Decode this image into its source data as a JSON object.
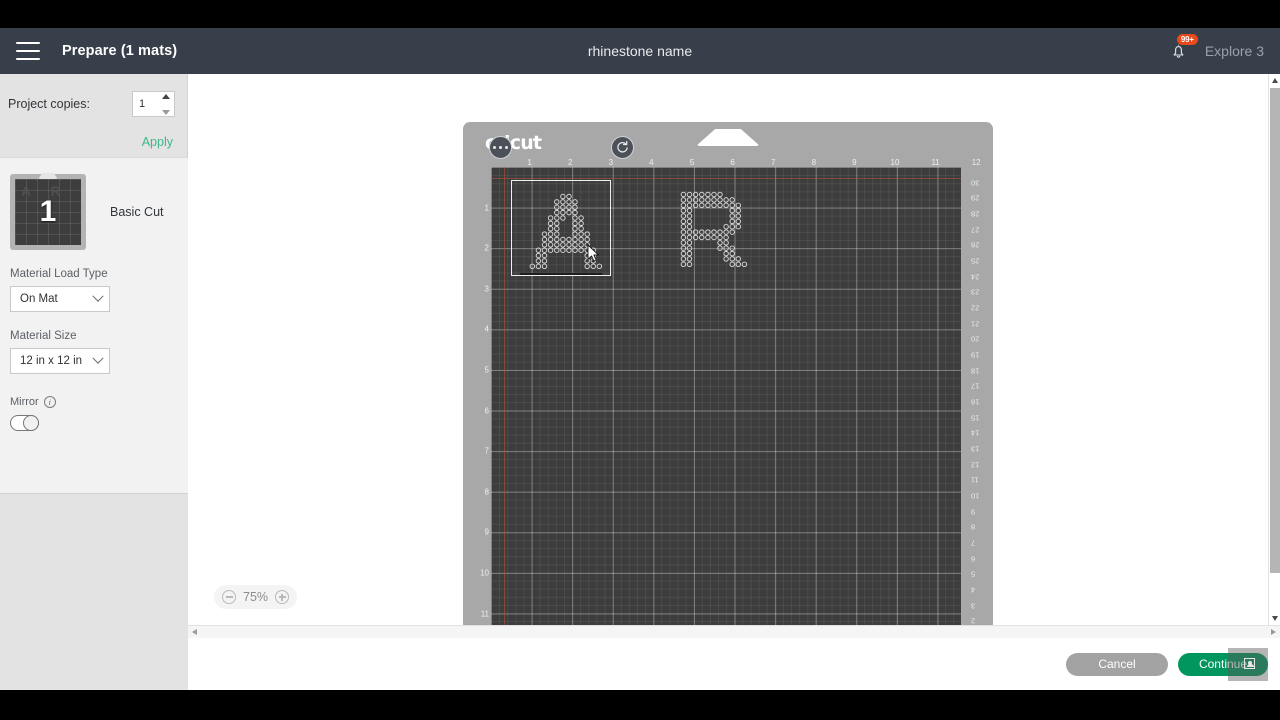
{
  "header": {
    "menu_icon": "hamburger-menu-icon",
    "title": "Prepare (1 mats)",
    "project_name": "rhinestone name",
    "bell_icon": "notification-bell-icon",
    "notification_badge": "99+",
    "machine": "Explore 3"
  },
  "sidebar": {
    "copies_label": "Project copies:",
    "copies_value": "1",
    "apply_label": "Apply",
    "mat": {
      "number": "1",
      "operation_label": "Basic Cut",
      "thumb_letters": "A R"
    },
    "material_load_type_label": "Material Load Type",
    "material_load_type_value": "On Mat",
    "material_size_label": "Material Size",
    "material_size_value": "12 in x 12 in",
    "mirror_label": "Mirror",
    "mirror_info_icon": "info-icon",
    "mirror_enabled": false
  },
  "canvas": {
    "mat_brand": "cricut",
    "more_options_icon": "ellipsis-icon",
    "rotate_icon": "rotate-icon",
    "ruler_top_ticks": [
      "1",
      "2",
      "3",
      "4",
      "5",
      "6",
      "7",
      "8",
      "9",
      "10",
      "11",
      "12"
    ],
    "ruler_left_ticks": [
      "1",
      "2",
      "3",
      "4",
      "5",
      "6",
      "7",
      "8",
      "9",
      "10",
      "11"
    ],
    "ruler_right_ticks": [
      "30",
      "29",
      "28",
      "27",
      "26",
      "25",
      "24",
      "23",
      "22",
      "21",
      "20",
      "19",
      "18",
      "17",
      "16",
      "15",
      "14",
      "13",
      "12",
      "11",
      "10",
      "9",
      "8",
      "7",
      "6",
      "5",
      "4",
      "3",
      "2"
    ],
    "objects": [
      {
        "name": "letter-A",
        "glyph": "A",
        "selected": true
      },
      {
        "name": "letter-R",
        "glyph": "R",
        "selected": false
      }
    ],
    "zoom_level": "75%",
    "zoom_out_icon": "minus-circle-icon",
    "zoom_in_icon": "plus-circle-icon"
  },
  "footer": {
    "cancel_label": "Cancel",
    "continue_label": "Continue"
  },
  "colors": {
    "header_bg": "#373f4a",
    "accent_green": "#00965e",
    "apply_green": "#3db887",
    "badge_orange": "#e8491d",
    "mat_gray": "#a8a8a8",
    "grid_dark": "#3d3d3d"
  }
}
